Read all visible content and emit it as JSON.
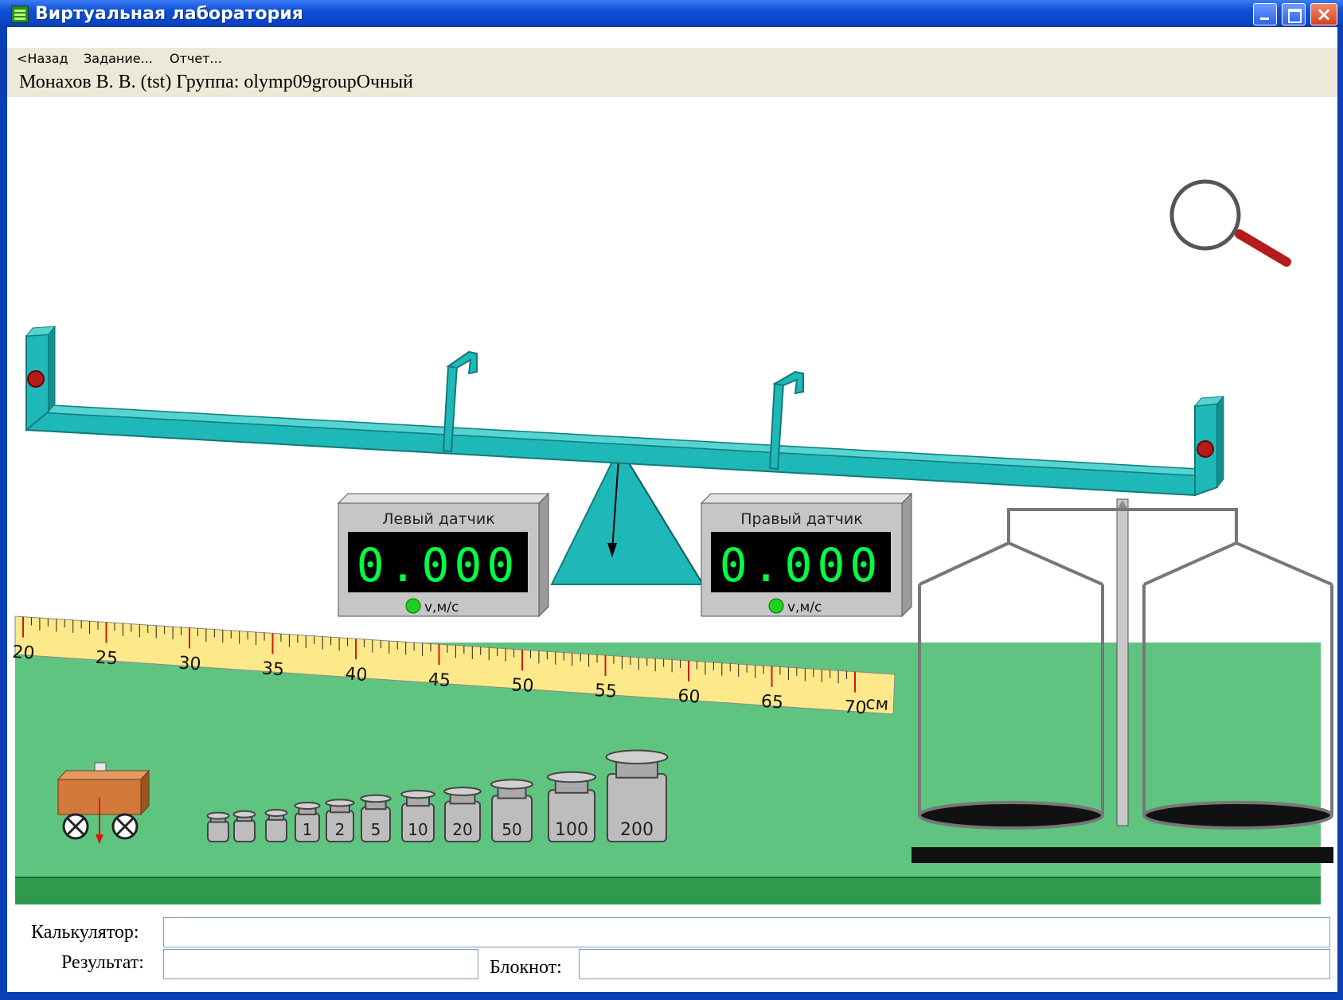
{
  "window": {
    "title": "Виртуальная лаборатория"
  },
  "menu": {
    "back": "<Назад",
    "task": "Задание...",
    "report": "Отчет..."
  },
  "user": {
    "info": "Монахов В. В. (tst)  Группа: olymp09groupОчный"
  },
  "sensors": {
    "left": {
      "title": "Левый датчик",
      "value": "0.000",
      "unit": "v,м/с"
    },
    "right": {
      "title": "Правый датчик",
      "value": "0.000",
      "unit": "v,м/с"
    }
  },
  "ruler": {
    "labels": [
      "20",
      "25",
      "30",
      "35",
      "40",
      "45",
      "50",
      "55",
      "60",
      "65",
      "70"
    ],
    "unit": "см"
  },
  "weights": [
    "",
    "",
    "",
    "1",
    "2",
    "5",
    "10",
    "20",
    "50",
    "100",
    "200"
  ],
  "bottom": {
    "calculator_label": "Калькулятор:",
    "result_label": "Результат:",
    "notepad_label": "Блокнот:",
    "calculator_value": "",
    "result_value": "",
    "notepad_value": ""
  },
  "colors": {
    "table": "#5fc47f",
    "table_edge": "#2f9a4e",
    "beam": "#1fb8b8",
    "ruler": "#fde98a",
    "display_bg": "#000000",
    "display_text": "#00ff44",
    "sensor_box": "#c6c6c6",
    "weight": "#bdbdbd",
    "cart": "#d2793c"
  },
  "icons": {
    "zoom": "magnifier-icon"
  }
}
